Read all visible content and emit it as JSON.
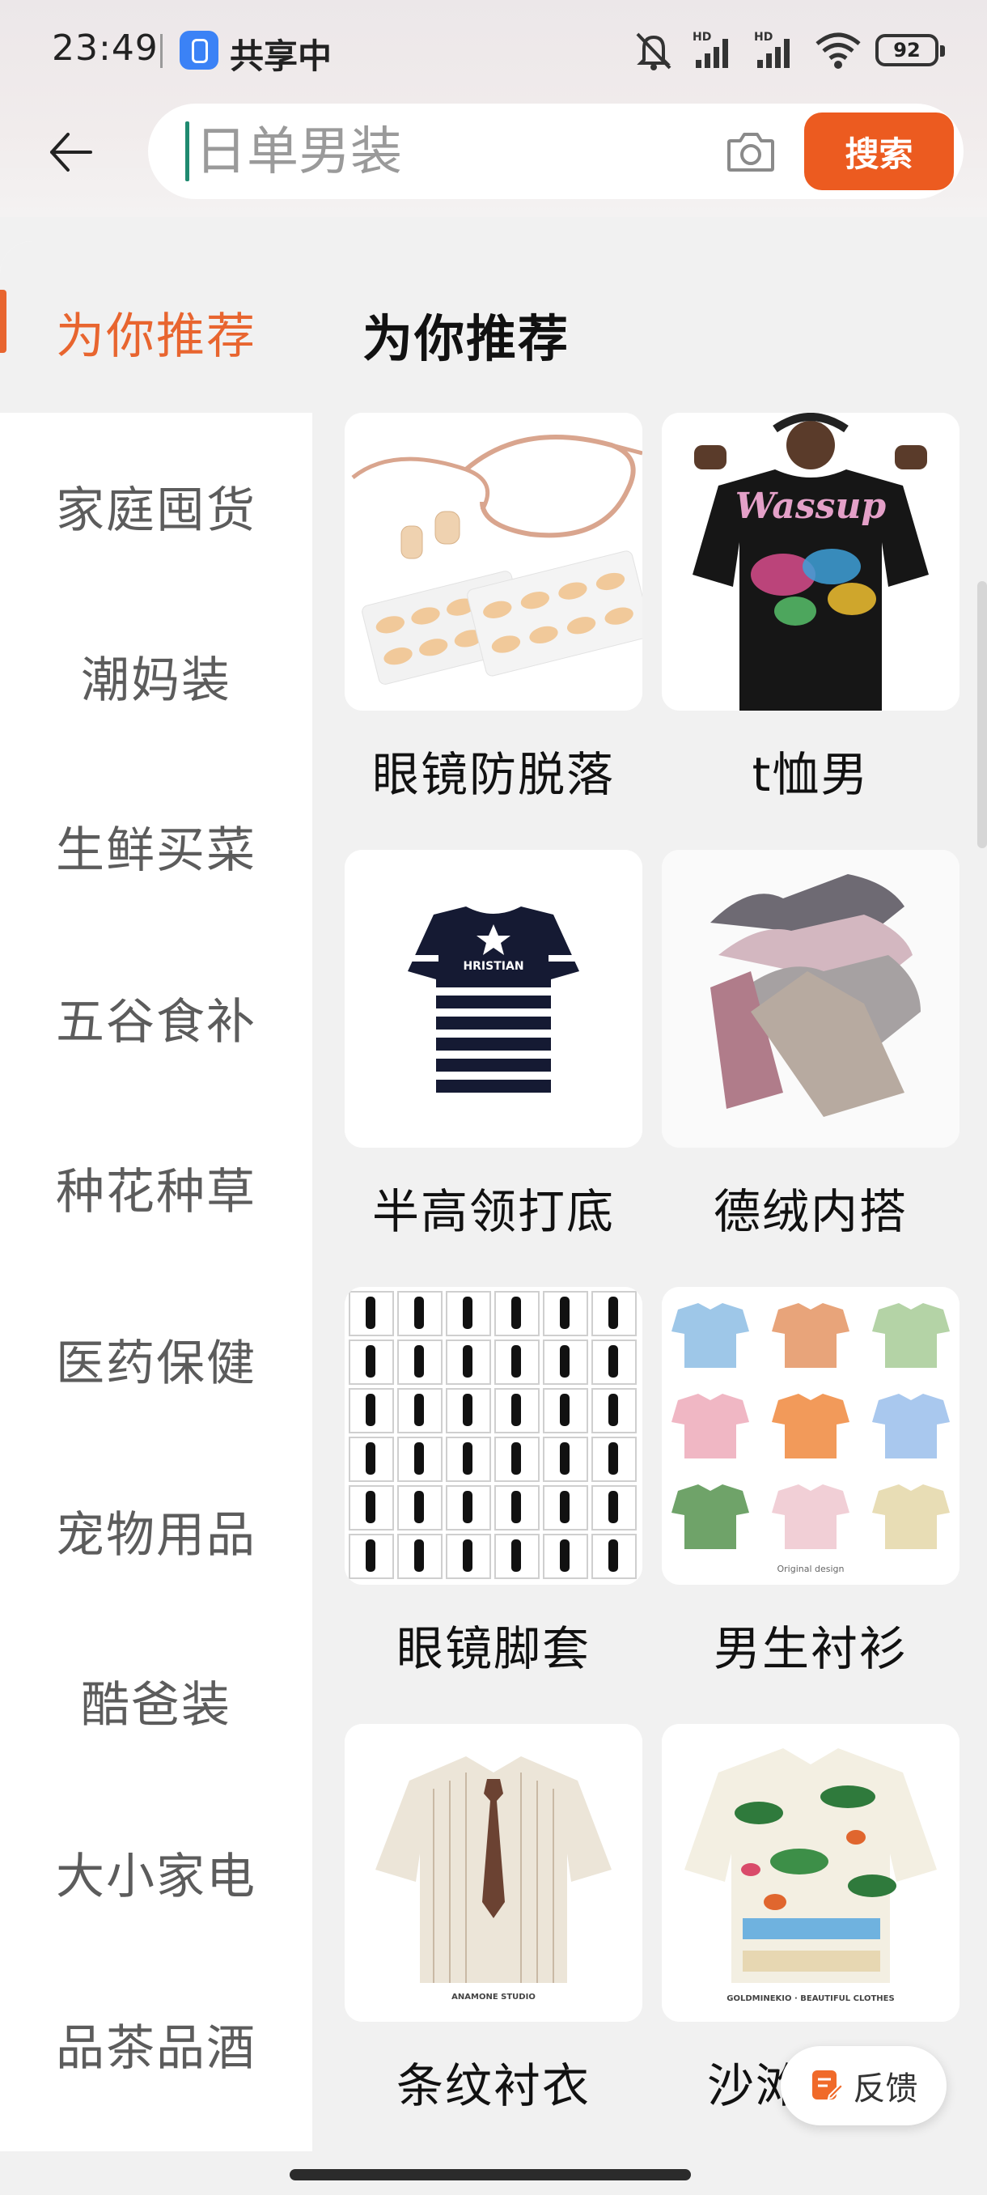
{
  "status_bar": {
    "time": "23:49",
    "share_text": "共享中",
    "battery": "92",
    "network_1": "HD",
    "network_2": "HD"
  },
  "search": {
    "placeholder": "日单男装",
    "button_label": "搜索"
  },
  "sidebar": {
    "items": [
      {
        "label": "为你推荐",
        "active": true
      },
      {
        "label": "家庭囤货"
      },
      {
        "label": "潮妈装"
      },
      {
        "label": "生鲜买菜"
      },
      {
        "label": "五谷食补"
      },
      {
        "label": "种花种草"
      },
      {
        "label": "医药保健"
      },
      {
        "label": "宠物用品"
      },
      {
        "label": "酷爸装"
      },
      {
        "label": "大小家电"
      },
      {
        "label": "品茶品酒"
      }
    ]
  },
  "main": {
    "section_title": "为你推荐",
    "products": [
      {
        "label": "眼镜防脱落",
        "image": "glasses-anti-slip-pads"
      },
      {
        "label": "t恤男",
        "image": "wassup-black-tshirt"
      },
      {
        "label": "半高领打底",
        "image": "striped-knit-top"
      },
      {
        "label": "德绒内搭",
        "image": "folded-camisoles"
      },
      {
        "label": "眼镜脚套",
        "image": "glasses-temple-tips-grid"
      },
      {
        "label": "男生衬衫",
        "image": "printed-shirts-grid"
      },
      {
        "label": "条纹衬衣",
        "image": "striped-shirt-with-tie"
      },
      {
        "label": "沙滩",
        "image": "hawaiian-print-shirt"
      }
    ],
    "image_captions": {
      "tshirt_print": "Wassup",
      "striped_top_print": "HRISTIAN",
      "shirts_grid_caption": "Original design",
      "striped_shirt_brand": "ANAMONE STUDIO",
      "hawaiian_brand": "GOLDMINEKIO · BEAUTIFUL CLOTHES"
    }
  },
  "feedback": {
    "label": "反馈"
  },
  "colors": {
    "accent": "#ec5b20",
    "active_text": "#e8652f"
  }
}
